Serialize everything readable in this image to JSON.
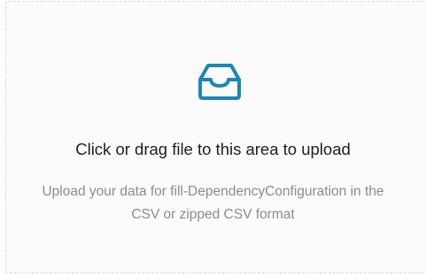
{
  "upload": {
    "icon": "inbox-icon",
    "accent_color": "#1b87b6",
    "title": "Click or drag file to this area to upload",
    "hint_line1": "Upload your data for fill-DependencyConfiguration in the",
    "hint_line2": "CSV or zipped CSV format"
  }
}
